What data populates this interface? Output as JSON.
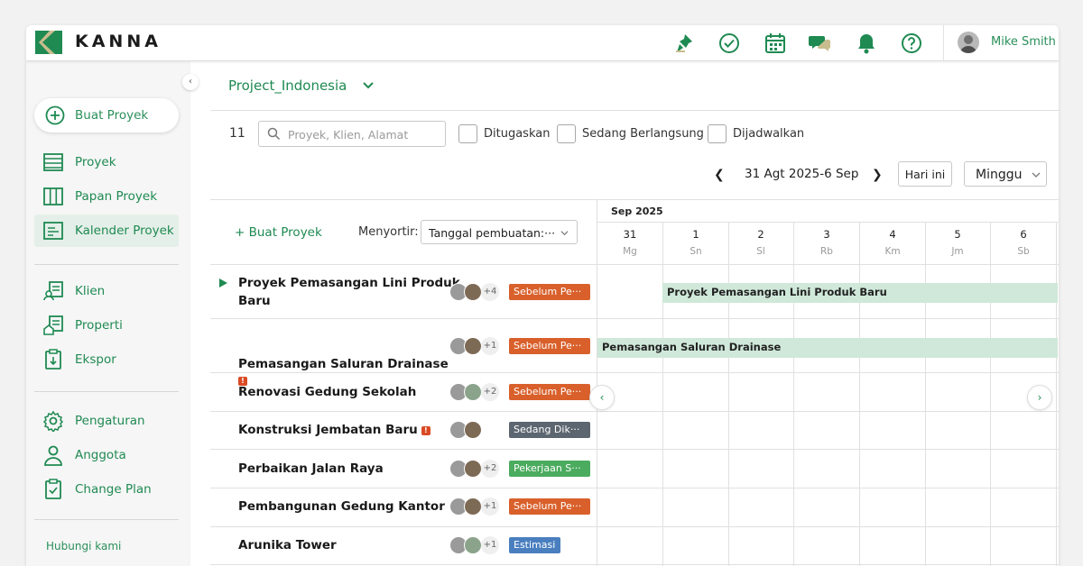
{
  "app": {
    "brand": "KANNA",
    "user": "Mike Smith"
  },
  "header_icons": [
    "pin-icon",
    "check-circle-icon",
    "calendar-icon",
    "chat-icon",
    "bell-icon",
    "help-icon"
  ],
  "sidebar": {
    "create_label": "Buat Proyek",
    "items_top": [
      {
        "label": "Proyek",
        "icon": "list-icon"
      },
      {
        "label": "Papan Proyek",
        "icon": "board-icon"
      },
      {
        "label": "Kalender Proyek",
        "icon": "calendar-list-icon",
        "active": true
      }
    ],
    "items_mid": [
      {
        "label": "Klien",
        "icon": "client-icon"
      },
      {
        "label": "Properti",
        "icon": "property-icon"
      },
      {
        "label": "Ekspor",
        "icon": "export-icon"
      }
    ],
    "items_bottom": [
      {
        "label": "Pengaturan",
        "icon": "gear-icon"
      },
      {
        "label": "Anggota",
        "icon": "person-icon"
      },
      {
        "label": "Change Plan",
        "icon": "clipboard-check-icon"
      }
    ],
    "contact": "Hubungi kami"
  },
  "main": {
    "project_name": "Project_Indonesia",
    "count": "11",
    "search_placeholder": "Proyek, Klien, Alamat",
    "filters": [
      "Ditugaskan",
      "Sedang Berlangsung",
      "Dijadwalkan"
    ],
    "date_range": "31 Agt 2025-6 Sep",
    "today_label": "Hari ini",
    "view_label": "Minggu",
    "create_link": "+ Buat Proyek",
    "sort_label": "Menyortir:",
    "sort_value": "Tanggal pembuatan:···",
    "month": "Sep 2025",
    "days": [
      {
        "num": "31",
        "name": "Mg"
      },
      {
        "num": "1",
        "name": "Sn"
      },
      {
        "num": "2",
        "name": "Sl"
      },
      {
        "num": "3",
        "name": "Rb"
      },
      {
        "num": "4",
        "name": "Km"
      },
      {
        "num": "5",
        "name": "Jm"
      },
      {
        "num": "6",
        "name": "Sb"
      }
    ],
    "rows": [
      {
        "name_line1": "Proyek Pemasangan Lini Produk",
        "name_line2": "Baru",
        "more": "+4",
        "status": "Sebelum Pe···",
        "status_color": "#d9602b",
        "bar": "Proyek Pemasangan Lini Produk Baru"
      },
      {
        "name_line1": "Pemasangan Saluran Drainase",
        "name_line2": "",
        "more": "+1",
        "status": "Sebelum Pe···",
        "status_color": "#d9602b",
        "bar": "Pemasangan Saluran Drainase"
      },
      {
        "name_line1": "Renovasi Gedung Sekolah",
        "more": "+2",
        "status": "Sebelum Pe···",
        "status_color": "#d9602b"
      },
      {
        "name_line1": "Konstruksi Jembatan Baru",
        "more": "",
        "status": "Sedang Dik···",
        "status_color": "#5c6670"
      },
      {
        "name_line1": "Perbaikan Jalan Raya",
        "more": "+2",
        "status": "Pekerjaan S···",
        "status_color": "#4bab5e"
      },
      {
        "name_line1": "Pembangunan Gedung Kantor",
        "more": "+1",
        "status": "Sebelum Pe···",
        "status_color": "#d9602b"
      },
      {
        "name_line1": "Arunika Tower",
        "more": "+1",
        "status": "Estimasi",
        "status_color": "#4a7fbf"
      }
    ]
  },
  "colors": {
    "accent": "#1f8a52",
    "gantt_bar": "#cfe8d9"
  }
}
